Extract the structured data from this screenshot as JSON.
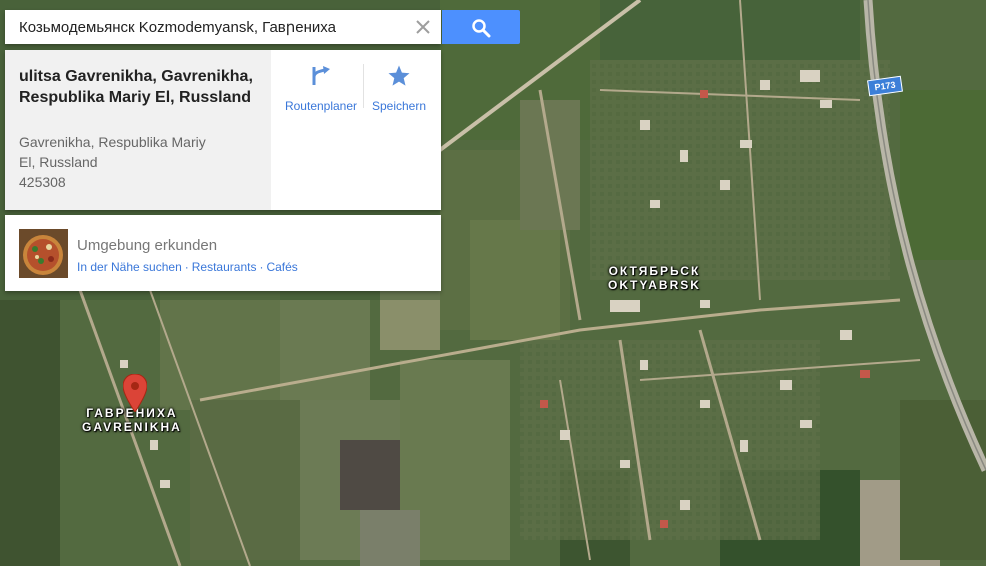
{
  "search": {
    "value": "Козьмодемьянск Kozmodemyansk, Гавրениха"
  },
  "place": {
    "title": "ulitsa Gavrenikha, Gavrenikha, Respublika Mariy El, Russland",
    "address_line1": "Gavrenikha, Respublika Mariy",
    "address_line2": "El, Russland",
    "postal_code": "425308"
  },
  "actions": {
    "route_label": "Routenplaner",
    "save_label": "Speichern"
  },
  "explore": {
    "title": "Umgebung erkunden",
    "links": [
      "In der Nähe suchen",
      "Restaurants",
      "Cafés"
    ],
    "separator": "·"
  },
  "map": {
    "labels": {
      "oktyabrsk_cyr": "ОКТЯБРЬСК",
      "oktyabrsk_lat": "OKTYABRSK",
      "gavrenikha_cyr": "ГАВРЕНИХА",
      "gavrenikha_lat": "GAVRENIKHA"
    },
    "road_shield": "P173"
  },
  "colors": {
    "accent": "#4d90fe",
    "link": "#3a77d9",
    "pin": "#db4437"
  },
  "icons": [
    "search-icon",
    "close-icon",
    "directions-icon",
    "star-icon",
    "map-pin-icon"
  ]
}
